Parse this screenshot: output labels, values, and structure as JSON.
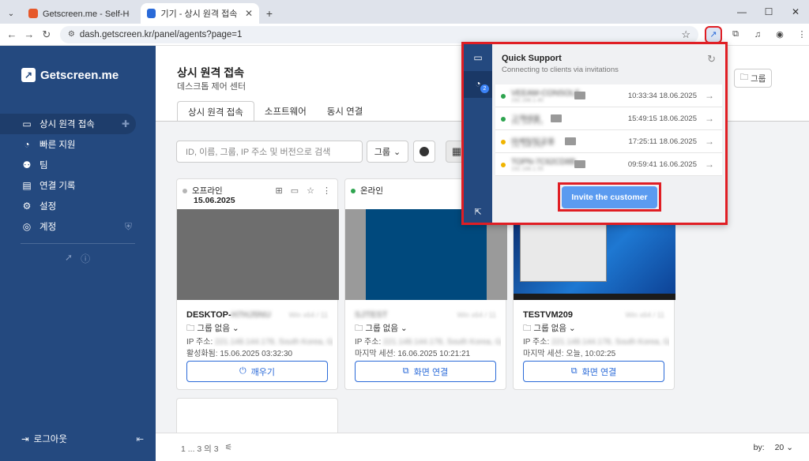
{
  "browser": {
    "tabs": [
      {
        "title": "Getscreen.me - Self-Hosted - ✕",
        "active": false
      },
      {
        "title": "기기 - 상시 원격 접속 - Getscre",
        "active": true
      }
    ],
    "new_tab": "+",
    "url": "dash.getscreen.kr/panel/agents?page=1"
  },
  "sidebar": {
    "brand": "Getscreen.me",
    "items": [
      {
        "label": "상시 원격 접속",
        "icon": "devices-icon",
        "active": true
      },
      {
        "label": "빠른 지원",
        "icon": "support-icon"
      },
      {
        "label": "팀",
        "icon": "team-icon"
      },
      {
        "label": "연결 기록",
        "icon": "history-icon"
      },
      {
        "label": "설정",
        "icon": "settings-icon"
      },
      {
        "label": "계정",
        "icon": "account-icon"
      }
    ],
    "logout": "로그아웃"
  },
  "page": {
    "title": "상시 원격 접속",
    "subtitle": "데스크톱 제어 센터",
    "group_button": "그룹",
    "tabs": [
      "상시 원격 접속",
      "소프트웨어",
      "동시 연결"
    ],
    "search_placeholder": "ID, 이름, 그룹, IP 주소 및 버전으로 검색",
    "filter": "그룹"
  },
  "cards": [
    {
      "status": "오프라인",
      "status_color": "#b5b5b5",
      "date": "15.06.2025",
      "name": "DESKTOP-",
      "name_blur": "H7HJ5NU",
      "os": "Win x64 / 11",
      "group": "그룹 없음",
      "ip_label": "IP 주소:",
      "ip_blur": "221.148.144.178, South Korea, Gyeo",
      "activity": "활성화됨: 15.06.2025 03:32:30",
      "button": "깨우기",
      "button_icon": "power-icon"
    },
    {
      "status": "온라인",
      "status_color": "#2ea44f",
      "date": "",
      "name": "",
      "name_blur": "SJTEST",
      "os": "Win x64 / 11",
      "group": "그룹 없음",
      "ip_label": "IP 주소:",
      "ip_blur": "221.148.144.178, South Korea, Gyeo",
      "activity": "마지막 세션: 16.06.2025 10:21:21",
      "button": "화면 연결",
      "button_icon": "screen-connect-icon"
    },
    {
      "status": "",
      "status_color": "#2ea44f",
      "date": "",
      "name": "TESTVM209",
      "name_blur": "",
      "os": "Win x64 / 11",
      "group": "그룹 없음",
      "ip_label": "IP 주소:",
      "ip_blur": "221.148.144.178, South Korea, Gyeo",
      "activity": "마지막 세션: 오늘, 10:02:25",
      "button": "화면 연결",
      "button_icon": "screen-connect-icon"
    }
  ],
  "footer": {
    "pagination": "1 ... 3 의 3",
    "per_page_label": "by:",
    "per_page": "20"
  },
  "quick_support": {
    "title": "Quick Support",
    "subtitle": "Connecting to clients via invitations",
    "badge": "2",
    "sessions": [
      {
        "name": "VEEAM-CONSOLE",
        "sub": "192.168.1.40",
        "time": "10:33:34 18.06.2025",
        "color": "#2ea44f"
      },
      {
        "name": "고객태블",
        "sub": "192.168.1.22",
        "time": "15:49:15 18.06.2025",
        "color": "#2ea44f"
      },
      {
        "name": "마케팅팀공용",
        "sub": "192.168.1.31",
        "time": "17:25:11 18.06.2025",
        "color": "#f0b400"
      },
      {
        "name": "TOPN-7C62CD8B",
        "sub": "192.168.1.55",
        "time": "09:59:41 16.06.2025",
        "color": "#f0b400"
      }
    ],
    "invite_button": "Invite the customer"
  }
}
